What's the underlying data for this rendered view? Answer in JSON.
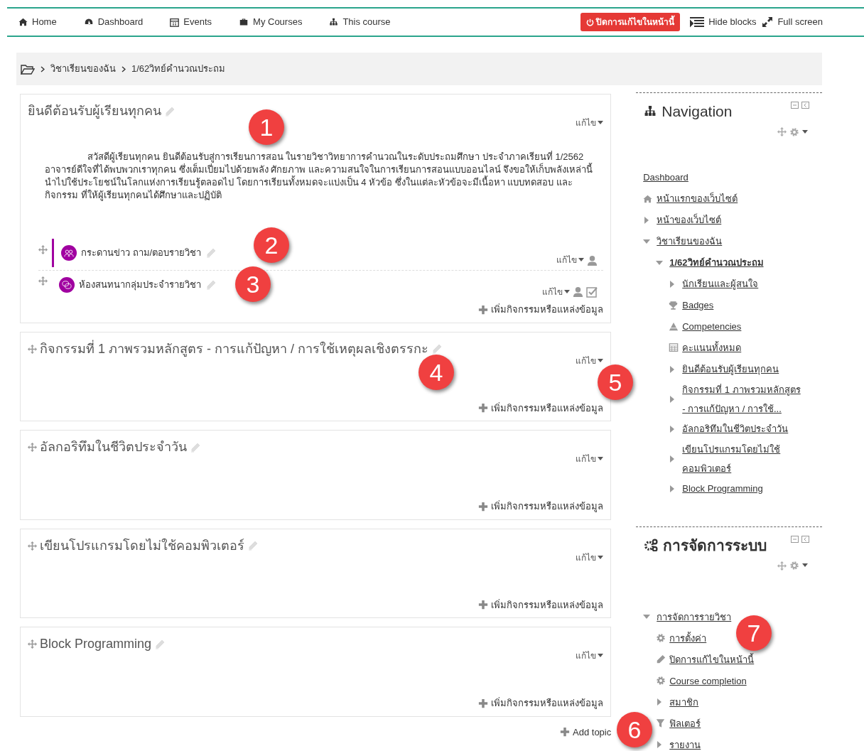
{
  "top_nav": {
    "items": [
      {
        "label": "Home",
        "kind": "home"
      },
      {
        "label": "Dashboard",
        "kind": "dashboard"
      },
      {
        "label": "Events",
        "kind": "events"
      },
      {
        "label": "My Courses",
        "kind": "courses"
      },
      {
        "label": "This course",
        "kind": "course"
      }
    ],
    "edit_button": "ปิดการแก้ไขในหน้านี้",
    "hide_blocks": "Hide blocks",
    "full_screen": "Full screen"
  },
  "breadcrumb": [
    "วิชาเรียนของฉัน",
    "1/62วิทย์คำนวณประถม"
  ],
  "sections": [
    {
      "title": "ยินดีต้อนรับผู้เรียนทุกคน",
      "movable": false,
      "edit": "แก้ไข",
      "summary": "สวัสดีผู้เรียนทุกคน ยินดีต้อนรับสู่การเรียนการสอน ในรายวิชาวิทยาการคำนวณในระดับประถมศึกษา ประจำภาคเรียนที่ 1/2562 อาจารย์ดีใจที่ได้พบพวกเราทุกคน ซึ่งเต็มเปี่ยมไปด้วยพลัง ศักยภาพ และความสนใจในการเรียนการสอนแบบออนไลน์ จึงขอให้เก็บพลังเหล่านี้ นำไปใช้ประโยชน์ในโลกแห่งการเรียนรู้ตลอดไป โดยการเรียนทั้งหมดจะแบ่งเป็น 4 หัวข้อ ซึ่งในแต่ละหัวข้อจะมีเนื้อหา แบบทดสอบ และกิจกรรม ที่ให้ผู้เรียนทุกคนได้ศึกษาและปฏิบัติ",
      "activities": [
        {
          "name": "กระดานข่าว ถาม/ตอบรายวิชา",
          "kind": "forum",
          "highlighted": true,
          "edit": "แก้ไข",
          "completion": false
        },
        {
          "name": "ห้องสนทนากลุ่มประจำรายวิชา",
          "kind": "chat",
          "highlighted": false,
          "edit": "แก้ไข",
          "completion": true
        }
      ],
      "add": "เพิ่มกิจกรรมหรือแหล่งข้อมูล"
    },
    {
      "title": "กิจกรรมที่ 1 ภาพรวมหลักสูตร - การแก้ปัญหา / การใช้เหตุผลเชิงตรรกะ",
      "movable": true,
      "edit": "แก้ไข",
      "add": "เพิ่มกิจกรรมหรือแหล่งข้อมูล"
    },
    {
      "title": "อัลกอริทึมในชีวิตประจำวัน",
      "movable": true,
      "edit": "แก้ไข",
      "add": "เพิ่มกิจกรรมหรือแหล่งข้อมูล"
    },
    {
      "title": "เขียนโปรแกรมโดยไม่ใช้คอมพิวเตอร์",
      "movable": true,
      "edit": "แก้ไข",
      "add": "เพิ่มกิจกรรมหรือแหล่งข้อมูล"
    },
    {
      "title": "Block Programming",
      "movable": true,
      "edit": "แก้ไข",
      "add": "เพิ่มกิจกรรมหรือแหล่งข้อมูล"
    }
  ],
  "add_topic": "Add topic",
  "blocks": [
    {
      "title": "Navigation",
      "kind": "navigation",
      "items": [
        {
          "label": "Dashboard",
          "kind": "link"
        },
        {
          "label": "หน้าแรกของเว็บไซต์",
          "kind": "site-home"
        },
        {
          "label": "หน้าของเว็บไซต์",
          "kind": "branch",
          "expanded": false
        },
        {
          "label": "วิชาเรียนของฉัน",
          "kind": "branch",
          "expanded": true,
          "children": [
            {
              "label": "1/62วิทย์คำนวณประถม",
              "kind": "course",
              "expanded": true,
              "children": [
                {
                  "label": "นักเรียนและผู้สนใจ",
                  "kind": "branch",
                  "expanded": false
                },
                {
                  "label": "Badges",
                  "kind": "badges"
                },
                {
                  "label": "Competencies",
                  "kind": "competencies"
                },
                {
                  "label": "คะแนนทั้งหมด",
                  "kind": "grades"
                },
                {
                  "label": "ยินดีต้อนรับผู้เรียนทุกคน",
                  "kind": "branch",
                  "expanded": false
                },
                {
                  "label": "กิจกรรมที่ 1 ภาพรวมหลักสูตร - การแก้ปัญหา / การใช้...",
                  "kind": "branch",
                  "expanded": false
                },
                {
                  "label": "อัลกอริทึมในชีวิตประจำวัน",
                  "kind": "branch",
                  "expanded": false
                },
                {
                  "label": "เขียนโปรแกรมโดยไม่ใช้คอมพิวเตอร์",
                  "kind": "branch",
                  "expanded": false
                },
                {
                  "label": "Block Programming",
                  "kind": "branch",
                  "expanded": false
                }
              ]
            }
          ]
        }
      ]
    },
    {
      "title": "การจัดการระบบ",
      "kind": "administration",
      "items": [
        {
          "label": "การจัดการรายวิชา",
          "kind": "branch",
          "expanded": true,
          "children": [
            {
              "label": "การตั้งค่า",
              "kind": "settings"
            },
            {
              "label": "ปิดการแก้ไขในหน้านี้",
              "kind": "edit"
            },
            {
              "label": "Course completion",
              "kind": "settings"
            },
            {
              "label": "สมาชิก",
              "kind": "branch",
              "expanded": false
            },
            {
              "label": "ฟิลเตอร์",
              "kind": "filter"
            },
            {
              "label": "รายงาน",
              "kind": "branch",
              "expanded": false
            }
          ]
        }
      ]
    }
  ],
  "callouts": [
    "1",
    "2",
    "3",
    "4",
    "5",
    "6",
    "7"
  ]
}
